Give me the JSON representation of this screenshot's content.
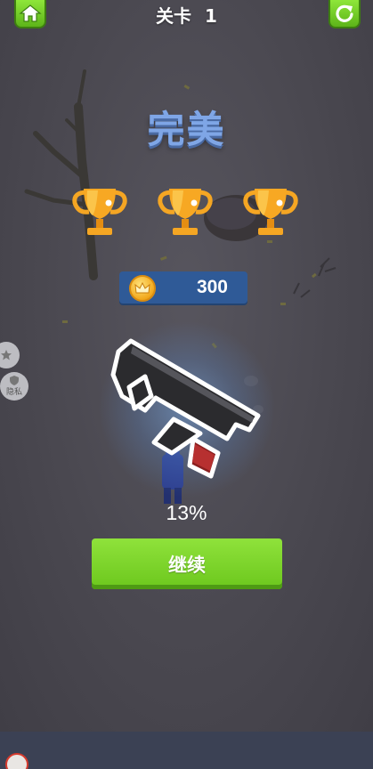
{
  "header": {
    "level_label": "关卡",
    "level_number": "1"
  },
  "result": {
    "title": "完美",
    "trophies_earned": 3,
    "trophies_total": 3
  },
  "reward": {
    "coin_amount": "300"
  },
  "unlock": {
    "item_icon": "submachine-gun",
    "progress_text": "13%",
    "progress_value": 0.13
  },
  "actions": {
    "continue_label": "继续"
  },
  "side_buttons": {
    "second_label": "隐私"
  },
  "colors": {
    "accent_green": "#7ed22c",
    "title_blue": "#7fa6e6",
    "panel_blue": "#2f5a97",
    "background": "#4b4951",
    "trophy_gold": "#f5a623"
  }
}
